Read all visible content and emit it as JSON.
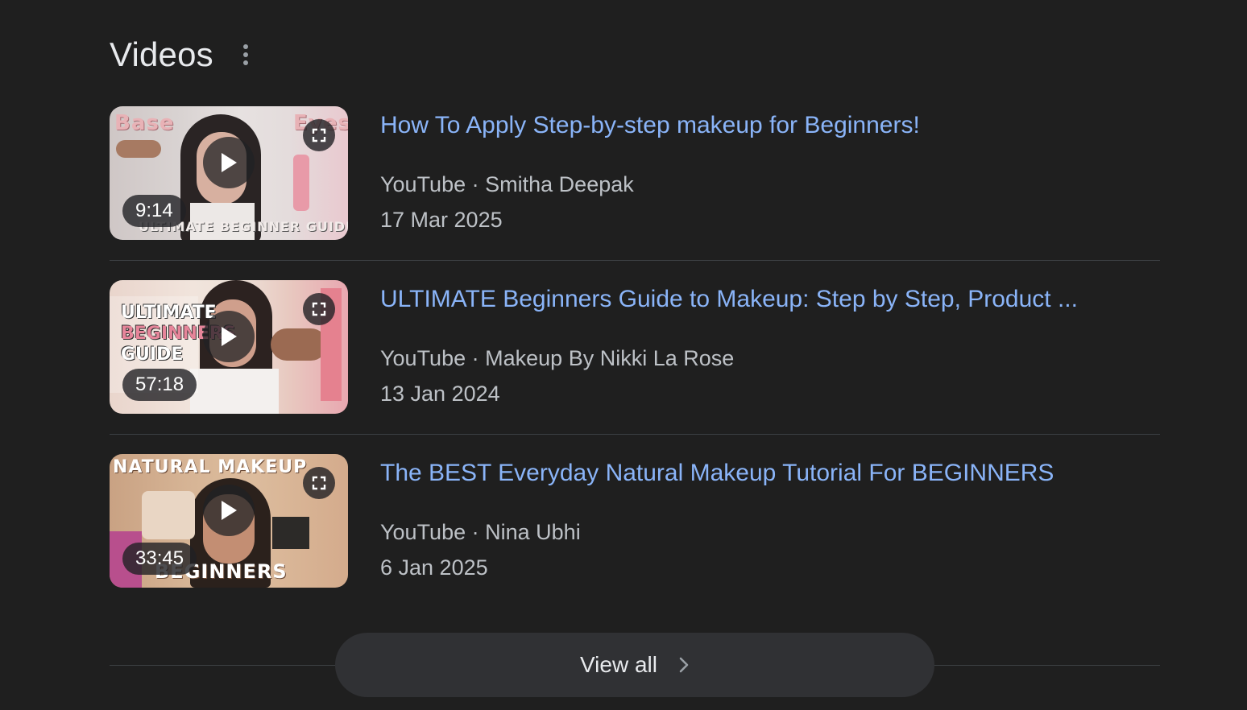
{
  "section": {
    "title": "Videos",
    "more_icon": "more-vert-icon"
  },
  "videos": [
    {
      "title": "How To Apply Step-by-step makeup for Beginners!",
      "source": "YouTube",
      "separator": "·",
      "channel": "Smitha Deepak",
      "date": "17 Mar 2025",
      "duration": "9:14",
      "thumb_texts": [
        "Base",
        "Eyes",
        "ULTIMATE BEGINNER GUIDE"
      ]
    },
    {
      "title": "ULTIMATE Beginners Guide to Makeup: Step by Step, Product ...",
      "source": "YouTube",
      "separator": "·",
      "channel": "Makeup By Nikki La Rose",
      "date": "13 Jan 2024",
      "duration": "57:18",
      "thumb_texts": [
        "ULTIMATE",
        "BEGINNERS",
        "GUIDE"
      ]
    },
    {
      "title": "The BEST Everyday Natural Makeup Tutorial For BEGINNERS",
      "source": "YouTube",
      "separator": "·",
      "channel": "Nina Ubhi",
      "date": "6 Jan 2025",
      "duration": "33:45",
      "thumb_texts": [
        "NATURAL MAKEUP",
        "BEGINNERS"
      ]
    }
  ],
  "view_all": {
    "label": "View all",
    "icon": "chevron-right-icon"
  },
  "colors": {
    "background": "#1f1f1f",
    "link": "#8ab4f8",
    "secondary_text": "#bdc1c6",
    "divider": "#3c4043",
    "button_bg": "#303134"
  }
}
